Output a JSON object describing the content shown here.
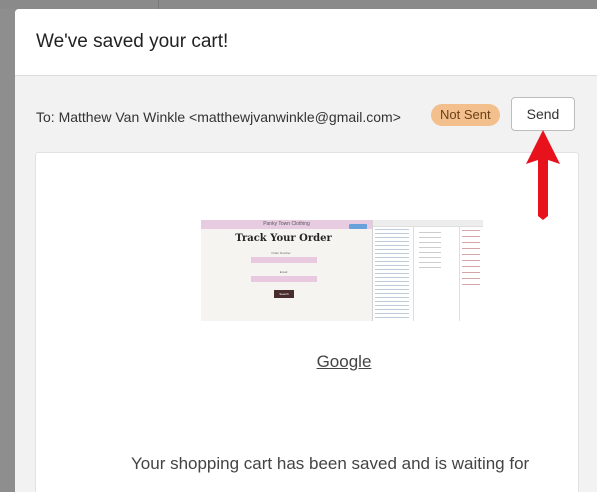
{
  "modal": {
    "title": "We've saved your cart!"
  },
  "recipient": {
    "label": "To: Matthew Van Winkle <matthewjvanwinkle@gmail.com>",
    "status": "Not Sent",
    "send_label": "Send"
  },
  "colors": {
    "status_badge_bg": "#f3c08d",
    "arrow": "#e8121d"
  },
  "email": {
    "thumbnail": {
      "site_name": "Panky Town Clothing",
      "heading": "Track Your Order",
      "field1_label": "Order Number",
      "field2_label": "Email",
      "button_label": "Search"
    },
    "link_text": "Google",
    "body_text": "Your shopping cart has been saved and is waiting for"
  }
}
